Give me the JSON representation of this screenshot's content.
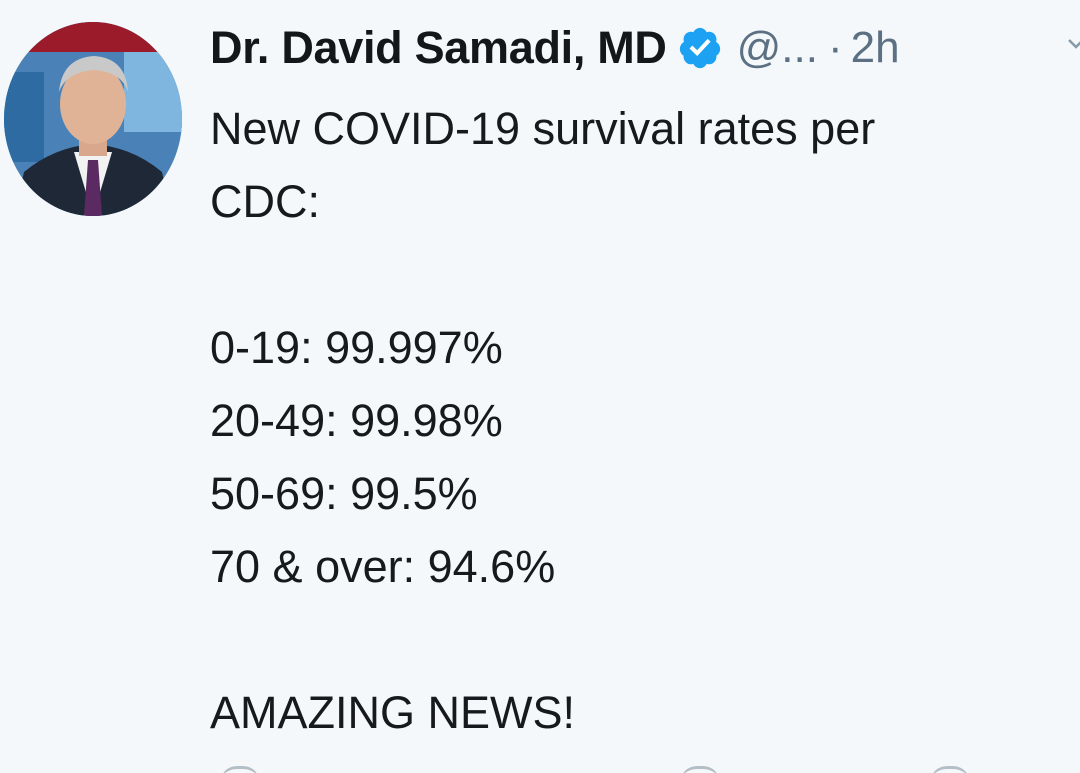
{
  "tweet": {
    "display_name": "Dr. David Samadi, MD",
    "handle": "@...",
    "separator": "·",
    "timestamp": "2h",
    "lines": [
      "New COVID-19 survival rates per",
      "CDC:",
      "",
      "0-19: 99.997%",
      "20-49: 99.98%",
      "50-69: 99.5%",
      "70 & over: 94.6%",
      "",
      "AMAZING NEWS!"
    ]
  },
  "icons": {
    "verified": "verified-badge-icon",
    "caret": "chevron-down-icon",
    "avatar": "profile-photo"
  },
  "colors": {
    "background": "#f4f8fb",
    "text": "#16191d",
    "secondary": "#5b7083",
    "verified": "#1da1f2"
  }
}
